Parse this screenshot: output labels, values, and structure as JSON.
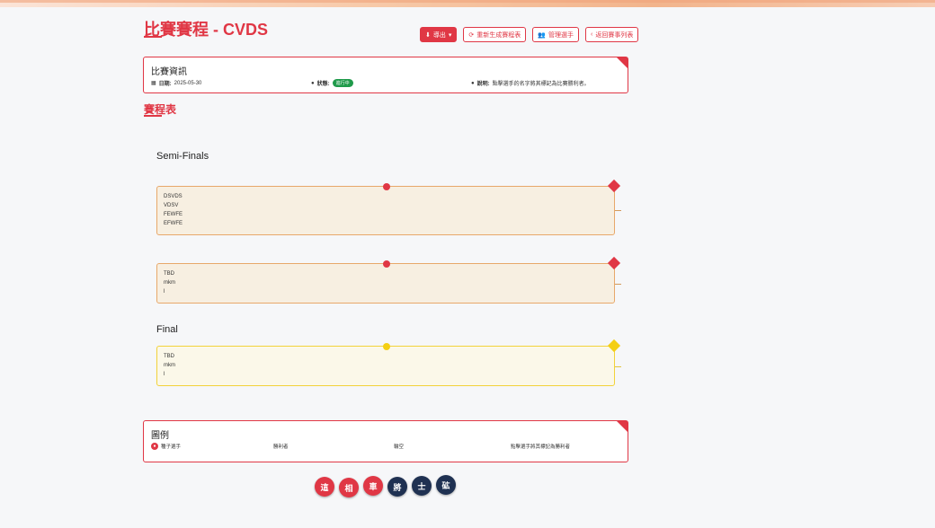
{
  "page": {
    "title": "比賽賽程 - CVDS"
  },
  "toolbar": {
    "export_label": "導出",
    "regenerate_label": "重新生成賽程表",
    "manage_players_label": "管理選手",
    "back_label": "返回賽事列表"
  },
  "info": {
    "title": "比賽資訊",
    "date_label": "日期:",
    "date_value": "2025-05-30",
    "status_label": "狀態:",
    "status_value": "進行中",
    "note_label": "說明:",
    "note_value": "點擊選手的名字將其標記為比賽勝利者。"
  },
  "bracket": {
    "section_title": "賽程表",
    "rounds": [
      {
        "title": "Semi-Finals",
        "matches": [
          {
            "players": [
              "DSVDS",
              "VDSV",
              "FEWFE",
              "EFWFE"
            ]
          },
          {
            "players": [
              "TBD",
              "mkm",
              "l"
            ]
          }
        ]
      },
      {
        "title": "Final",
        "matches": [
          {
            "players": [
              "TBD",
              "mkm",
              "l"
            ]
          }
        ]
      }
    ]
  },
  "legend": {
    "title": "圖例",
    "items": [
      {
        "label": "種子選手",
        "icon": "seed-badge"
      },
      {
        "label": "勝利者"
      },
      {
        "label": "輪空"
      },
      {
        "label": "點擊選手將其標記為勝利者"
      }
    ]
  },
  "pieces": [
    {
      "char": "這",
      "color": "red"
    },
    {
      "char": "相",
      "color": "red"
    },
    {
      "char": "車",
      "color": "red"
    },
    {
      "char": "將",
      "color": "navy"
    },
    {
      "char": "士",
      "color": "navy"
    },
    {
      "char": "砿",
      "color": "navy"
    }
  ],
  "colors": {
    "accent": "#e03745",
    "semi_match_bg": "#f7efe1",
    "final_match_bg": "#fbf8e9",
    "final_accent": "#f4cf14",
    "status_green": "#1f9a4a",
    "navy": "#1f3152"
  }
}
